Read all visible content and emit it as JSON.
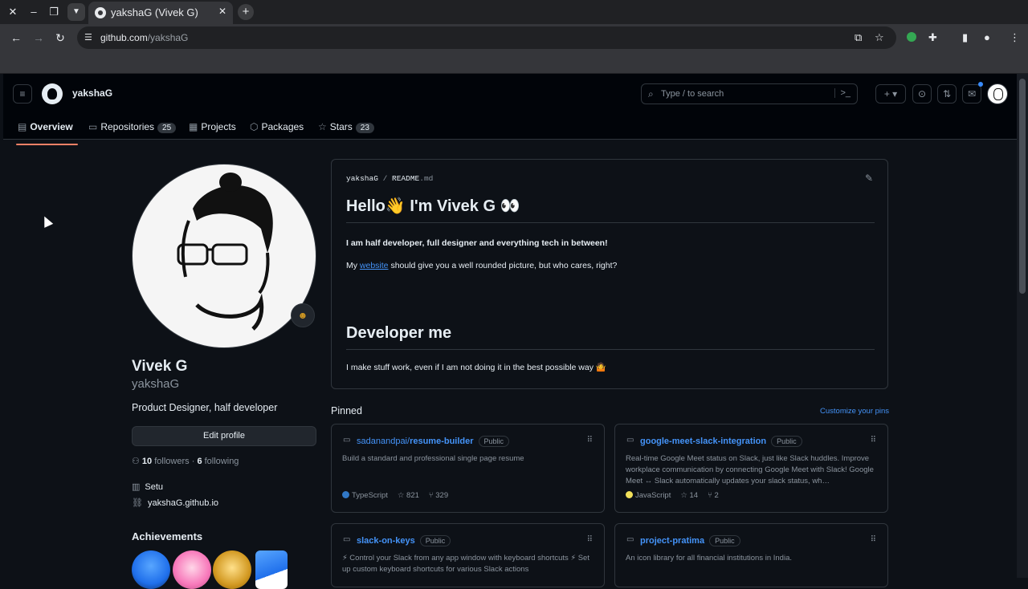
{
  "browser": {
    "tab_title": "yakshaG (Vivek G)",
    "url_host": "github.com",
    "url_path": "/yakshaG"
  },
  "header": {
    "username": "yakshaG",
    "search_placeholder": "Type / to search"
  },
  "profile_tabs": [
    {
      "label": "Overview",
      "count": ""
    },
    {
      "label": "Repositories",
      "count": "25"
    },
    {
      "label": "Projects",
      "count": ""
    },
    {
      "label": "Packages",
      "count": ""
    },
    {
      "label": "Stars",
      "count": "23"
    }
  ],
  "profile": {
    "name": "Vivek G",
    "login": "yakshaG",
    "bio": "Product Designer, half developer",
    "edit_label": "Edit profile",
    "followers_count": "10",
    "followers_label": "followers",
    "following_count": "6",
    "following_label": "following",
    "company": "Setu",
    "website": "yakshaG.github.io",
    "achievements_title": "Achievements"
  },
  "readme": {
    "owner": "yakshaG",
    "separator": "/",
    "file": "README",
    "ext": ".md",
    "h1": "Hello👋 I'm Vivek G 👀",
    "p1": "I am half developer, full designer and everything tech in between!",
    "p2_before": "My ",
    "p2_link": "website",
    "p2_after": " should give you a well rounded picture, but who cares, right?",
    "h2": "Developer me",
    "p3": "I make stuff work, even if I am not doing it in the best possible way 🤷"
  },
  "pinned": {
    "title": "Pinned",
    "customize": "Customize your pins",
    "cards": [
      {
        "owner": "sadanandpai/",
        "name": "resume-builder",
        "visibility": "Public",
        "desc": "Build a standard and professional single page resume",
        "lang": "TypeScript",
        "lang_color": "#3178c6",
        "stars": "821",
        "forks": "329"
      },
      {
        "owner": "",
        "name": "google-meet-slack-integration",
        "visibility": "Public",
        "desc": "Real-time Google Meet status on Slack, just like Slack huddles. Improve workplace communication by connecting Google Meet with Slack! Google Meet ↔ Slack automatically updates your slack status, wh…",
        "lang": "JavaScript",
        "lang_color": "#f1e05a",
        "stars": "14",
        "forks": "2"
      },
      {
        "owner": "",
        "name": "slack-on-keys",
        "visibility": "Public",
        "desc": "⚡ Control your Slack from any app window with keyboard shortcuts ⚡ Set up custom keyboard shortcuts for various Slack actions",
        "lang": "",
        "lang_color": "",
        "stars": "",
        "forks": ""
      },
      {
        "owner": "",
        "name": "project-pratima",
        "visibility": "Public",
        "desc": "An icon library for all financial institutions in India.",
        "lang": "",
        "lang_color": "",
        "stars": "",
        "forks": ""
      }
    ]
  }
}
